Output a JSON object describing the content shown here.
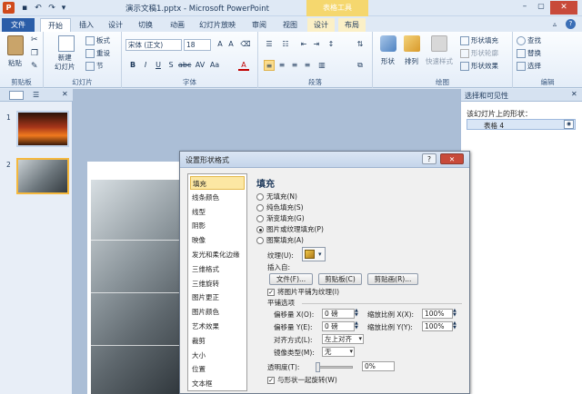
{
  "window": {
    "title": "演示文稿1.pptx - Microsoft PowerPoint",
    "context_tab_group": "表格工具"
  },
  "tabs": {
    "file": "文件",
    "home": "开始",
    "insert": "插入",
    "design": "设计",
    "transitions": "切换",
    "animations": "动画",
    "slideshow": "幻灯片放映",
    "review": "审阅",
    "view": "视图",
    "table_design": "设计",
    "table_layout": "布局"
  },
  "ribbon": {
    "clipboard": {
      "label": "剪贴板",
      "paste": "粘贴"
    },
    "slides": {
      "label": "幻灯片",
      "new_slide": "新建\n幻灯片",
      "layout": "板式",
      "reset": "重设",
      "section": "节"
    },
    "font": {
      "label": "字体",
      "font_name": "宋体 (正文)",
      "font_size": "18"
    },
    "paragraph": {
      "label": "段落"
    },
    "drawing": {
      "label": "绘图",
      "shapes": "形状",
      "arrange": "排列",
      "quick_styles": "快速样式",
      "shape_fill": "形状填充",
      "shape_outline": "形状轮廓",
      "shape_effects": "形状效果"
    },
    "editing": {
      "label": "编辑",
      "find": "查找",
      "replace": "替换",
      "select": "选择"
    }
  },
  "left_pane": {
    "slide_numbers": [
      "1",
      "2"
    ]
  },
  "right_pane": {
    "title": "选择和可见性",
    "subtitle": "该幻灯片上的形状：",
    "item": "表格 4"
  },
  "dialog": {
    "title": "设置形状格式",
    "help": "?",
    "close": "✕",
    "nav_items": [
      "填充",
      "线条颜色",
      "线型",
      "阴影",
      "映像",
      "发光和柔化边缘",
      "三维格式",
      "三维旋转",
      "图片更正",
      "图片颜色",
      "艺术效果",
      "裁剪",
      "大小",
      "位置",
      "文本框"
    ],
    "section_title": "填充",
    "fill_options": [
      "无填充(N)",
      "纯色填充(S)",
      "渐变填充(G)",
      "图片或纹理填充(P)",
      "图案填充(A)"
    ],
    "texture_label": "纹理(U):",
    "insert_from": "插入自:",
    "file_btn": "文件(F)...",
    "clipboard_btn": "剪贴板(C)",
    "clipart_btn": "剪贴画(R)...",
    "tile_check": "将图片平铺为纹理(I)",
    "tile_options": "平铺选项",
    "offset_x_label": "偏移量 X(O):",
    "offset_x": "0 磅",
    "scale_x_label": "缩放比例 X(X):",
    "scale_x": "100%",
    "offset_y_label": "偏移量 Y(E):",
    "offset_y": "0 磅",
    "scale_y_label": "缩放比例 Y(Y):",
    "scale_y": "100%",
    "align_label": "对齐方式(L):",
    "align_value": "左上对齐",
    "mirror_label": "镜像类型(M):",
    "mirror_value": "无",
    "transparency_label": "透明度(T):",
    "transparency_value": "0%",
    "rotate_check": "与形状一起旋转(W)"
  },
  "colors": {
    "file_tab": "#2a5da8",
    "context": "#f5d76e",
    "accent": "#f5b83d"
  }
}
